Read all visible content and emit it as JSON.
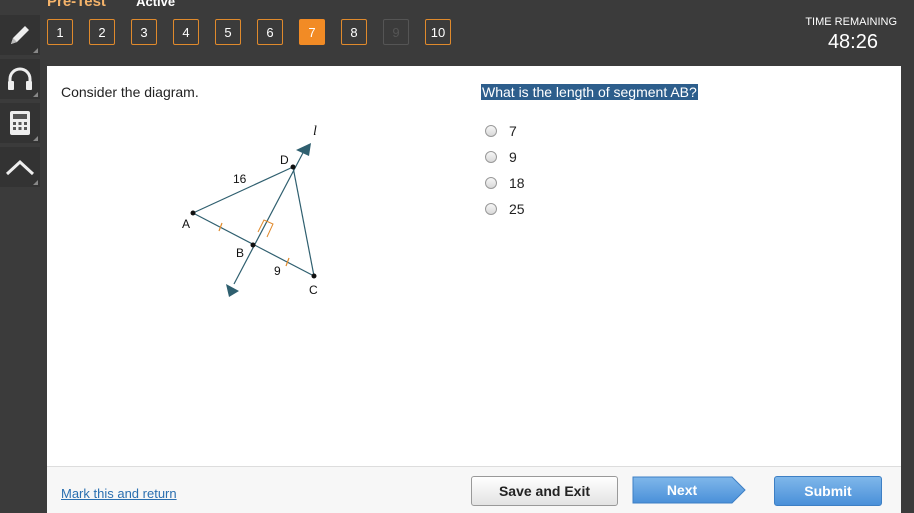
{
  "header": {
    "title": "Pre-Test",
    "status": "Active"
  },
  "question_nav": [
    {
      "label": "1",
      "state": "normal"
    },
    {
      "label": "2",
      "state": "normal"
    },
    {
      "label": "3",
      "state": "normal"
    },
    {
      "label": "4",
      "state": "normal"
    },
    {
      "label": "5",
      "state": "normal"
    },
    {
      "label": "6",
      "state": "normal"
    },
    {
      "label": "7",
      "state": "current"
    },
    {
      "label": "8",
      "state": "normal"
    },
    {
      "label": "9",
      "state": "disabled"
    },
    {
      "label": "10",
      "state": "normal"
    }
  ],
  "timer": {
    "label": "TIME REMAINING",
    "value": "48:26"
  },
  "tools": [
    {
      "icon": "pencil-icon"
    },
    {
      "icon": "headphones-icon"
    },
    {
      "icon": "calculator-icon"
    },
    {
      "icon": "collapse-up-icon"
    }
  ],
  "content": {
    "prompt": "Consider the diagram.",
    "question": "What is the length of segment AB?",
    "options": [
      "7",
      "9",
      "18",
      "25"
    ],
    "diagram": {
      "labels": {
        "line": "l",
        "A": "A",
        "B": "B",
        "C": "C",
        "D": "D",
        "len_AD": "16",
        "len_BC": "9"
      }
    }
  },
  "footer": {
    "mark_link": "Mark this and return",
    "save_exit": "Save and Exit",
    "next": "Next",
    "submit": "Submit"
  },
  "colors": {
    "accent": "#f28b25",
    "selection": "#2d5e8c",
    "button_blue": "#4a90d9",
    "diagram_line": "#2f5f6f",
    "tick_mark": "#e08a2c"
  }
}
